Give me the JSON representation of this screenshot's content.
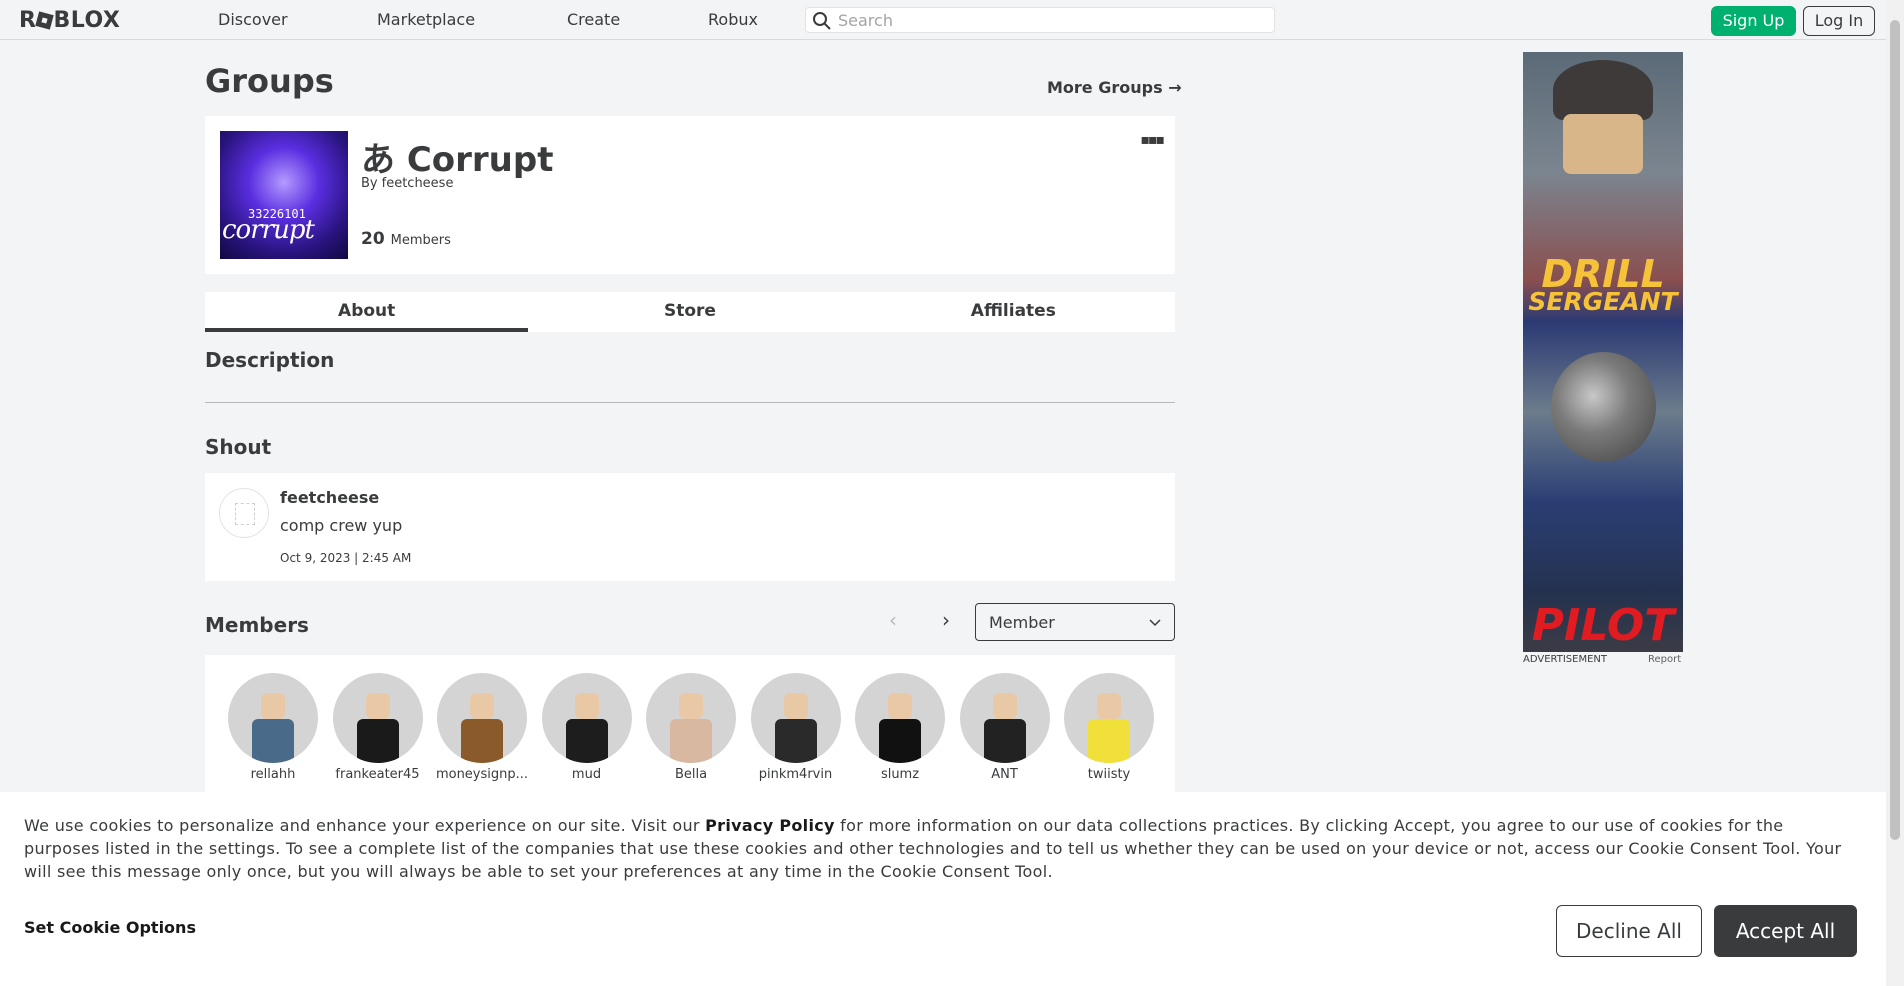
{
  "nav": {
    "logo": "ROBLOX",
    "links": [
      "Discover",
      "Marketplace",
      "Create",
      "Robux"
    ],
    "search_placeholder": "Search",
    "signup_label": "Sign Up",
    "login_label": "Log In"
  },
  "page": {
    "title": "Groups",
    "more_groups": "More Groups"
  },
  "group": {
    "name": "あ Corrupt",
    "by_label": "By",
    "owner": "feetcheese",
    "member_count": "20",
    "members_label": "Members",
    "thumb_code": "33226101",
    "thumb_text": "corrupt"
  },
  "tabs": [
    {
      "label": "About",
      "active": true
    },
    {
      "label": "Store",
      "active": false
    },
    {
      "label": "Affiliates",
      "active": false
    }
  ],
  "description": {
    "title": "Description"
  },
  "shout": {
    "title": "Shout",
    "author": "feetcheese",
    "body": "comp crew yup",
    "date": "Oct 9, 2023 | 2:45 AM"
  },
  "members": {
    "title": "Members",
    "role_selected": "Member",
    "list": [
      {
        "name": "rellahh",
        "shirt": "#4a6a8a"
      },
      {
        "name": "frankeater45",
        "shirt": "#1a1a1a"
      },
      {
        "name": "moneysignp...",
        "shirt": "#8a5a2a"
      },
      {
        "name": "mud",
        "shirt": "#1d1d1d"
      },
      {
        "name": "Bella",
        "shirt": "#d8b8a0"
      },
      {
        "name": "pinkm4rvin",
        "shirt": "#2a2a2a"
      },
      {
        "name": "slumz",
        "shirt": "#111111"
      },
      {
        "name": "ANT",
        "shirt": "#222222"
      },
      {
        "name": "twiisty",
        "shirt": "#f2e03a"
      }
    ]
  },
  "ad": {
    "line1": "DRILL",
    "line2": "SERGEANT",
    "line3": "PILOT",
    "label": "ADVERTISEMENT",
    "report": "Report"
  },
  "cookie": {
    "text_before": "We use cookies to personalize and enhance your experience on our site. Visit our ",
    "privacy_link": "Privacy Policy",
    "text_after": " for more information on our data collections practices. By clicking Accept, you agree to our use of cookies for the purposes listed in the settings. To see a complete list of the companies that use these cookies and other technologies and to tell us whether they can be used on your device or not, access our Cookie Consent Tool. Your will see this message only once, but you will always be able to set your preferences at any time in the Cookie Consent Tool.",
    "options_label": "Set Cookie Options",
    "decline_label": "Decline All",
    "accept_label": "Accept All"
  },
  "colors": {
    "brand_green": "#00b06f",
    "text_dark": "#393b3d",
    "background": "#f2f4f5"
  }
}
